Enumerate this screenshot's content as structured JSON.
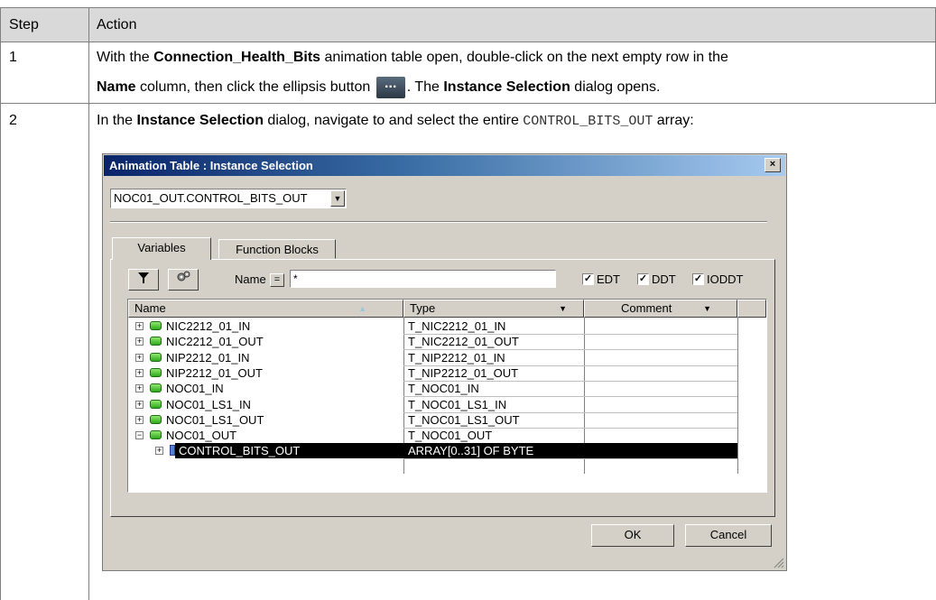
{
  "table": {
    "headers": {
      "step": "Step",
      "action": "Action"
    },
    "row1": {
      "step": "1",
      "line1_pre": "With the ",
      "line1_bold1": "Connection_Health_Bits",
      "line1_post": " animation table open, double-click on the next empty row in the",
      "line2_bold1": "Name",
      "line2_mid": " column, then click the ellipsis button ",
      "ellipsis_glyph": "...",
      "line2_mid2": ". The ",
      "line2_bold2": "Instance Selection",
      "line2_post": " dialog opens."
    },
    "row2": {
      "step": "2",
      "line1_pre": "In the ",
      "line1_bold": "Instance Selection",
      "line1_mid": " dialog, navigate to and select the entire ",
      "line1_code": "CONTROL_BITS_OUT",
      "line1_post": " array:"
    }
  },
  "dialog": {
    "title": "Animation Table : Instance Selection",
    "close_glyph": "×",
    "combo_value": "NOC01_OUT.CONTROL_BITS_OUT",
    "combo_arrow": "▼",
    "tabs": [
      "Variables",
      "Function Blocks"
    ],
    "filter_icon": "funnel-icon",
    "settings_icon": "gear-icon",
    "name_label": "Name",
    "eq_label": "=",
    "filter_value": "*",
    "checks": [
      {
        "label": "EDT",
        "checked": true
      },
      {
        "label": "DDT",
        "checked": true
      },
      {
        "label": "IODDT",
        "checked": true
      }
    ],
    "check_glyph": "✓",
    "columns": [
      {
        "label": "Name",
        "sort": "▲"
      },
      {
        "label": "Type",
        "sort": "▼"
      },
      {
        "label": "Comment",
        "sort": "▼"
      }
    ],
    "rows": [
      {
        "name": "NIC2212_01_IN",
        "type": "T_NIC2212_01_IN",
        "expander": "+"
      },
      {
        "name": "NIC2212_01_OUT",
        "type": "T_NIC2212_01_OUT",
        "expander": "+"
      },
      {
        "name": "NIP2212_01_IN",
        "type": "T_NIP2212_01_IN",
        "expander": "+"
      },
      {
        "name": "NIP2212_01_OUT",
        "type": "T_NIP2212_01_OUT",
        "expander": "+"
      },
      {
        "name": "NOC01_IN",
        "type": "T_NOC01_IN",
        "expander": "+"
      },
      {
        "name": "NOC01_LS1_IN",
        "type": "T_NOC01_LS1_IN",
        "expander": "+"
      },
      {
        "name": "NOC01_LS1_OUT",
        "type": "T_NOC01_LS1_OUT",
        "expander": "+"
      },
      {
        "name": "NOC01_OUT",
        "type": "T_NOC01_OUT",
        "expander": "−"
      },
      {
        "name": "CONTROL_BITS_OUT",
        "type": "ARRAY[0..31] OF BYTE",
        "expander": "+",
        "selected": true
      }
    ],
    "ok_label": "OK",
    "cancel_label": "Cancel"
  }
}
